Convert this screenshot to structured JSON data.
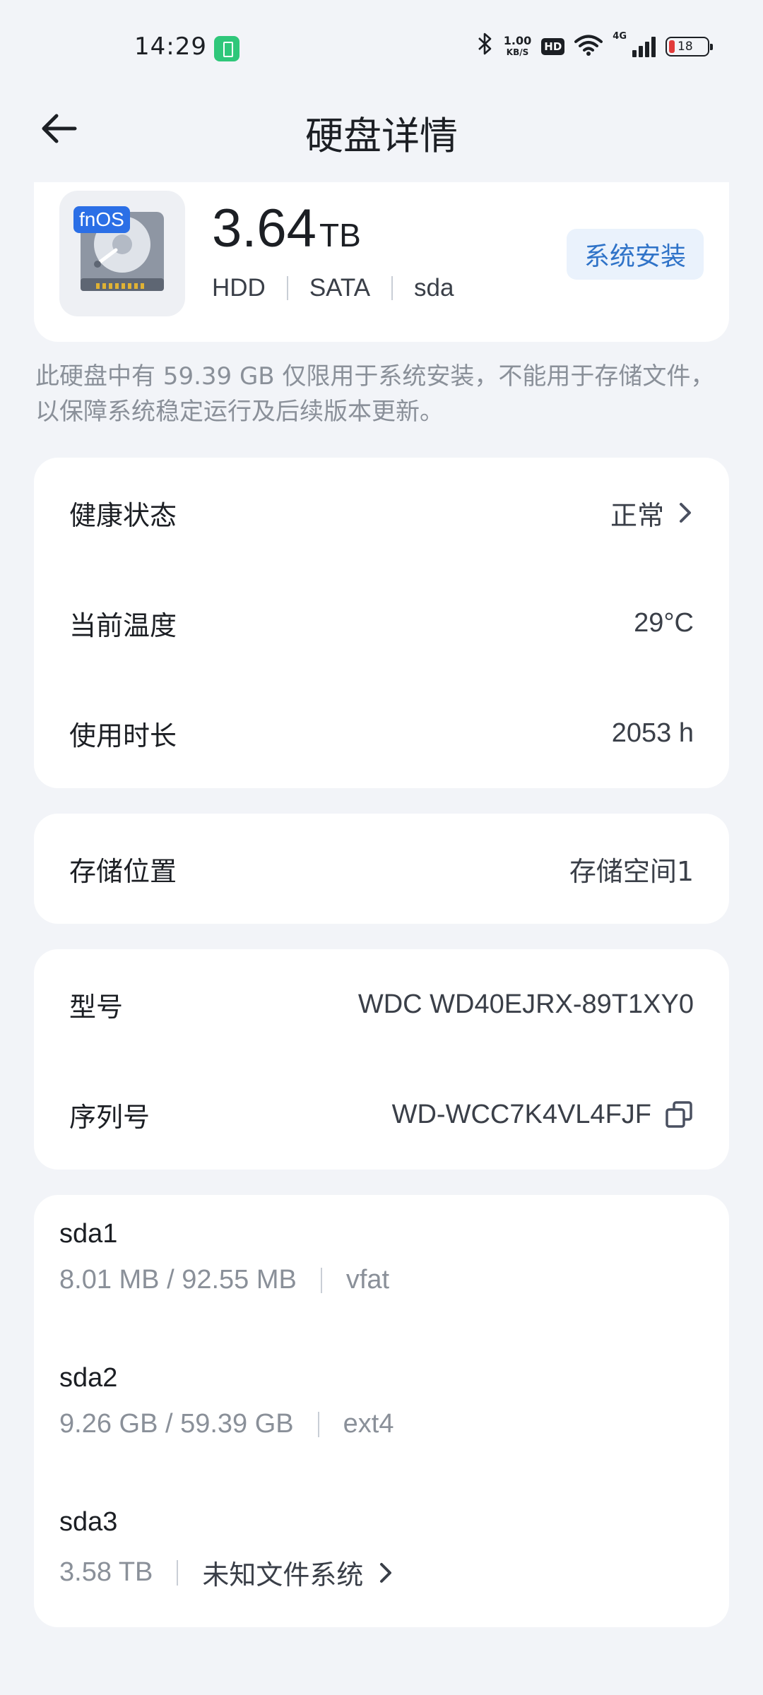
{
  "status_bar": {
    "time": "14:29",
    "net_speed_value": "1.00",
    "net_speed_unit": "KB/S",
    "hd_label": "HD",
    "network_type": "4G",
    "battery_level": "18"
  },
  "header": {
    "title": "硬盘详情"
  },
  "disk": {
    "badge": "fnOS",
    "capacity_value": "3.64",
    "capacity_unit": "TB",
    "type": "HDD",
    "interface": "SATA",
    "device": "sda",
    "tag": "系统安装"
  },
  "notice": "此硬盘中有 59.39 GB 仅限用于系统安装，不能用于存储文件，以保障系统稳定运行及后续版本更新。",
  "health": {
    "status_label": "健康状态",
    "status_value": "正常",
    "temp_label": "当前温度",
    "temp_value": "29°C",
    "usage_label": "使用时长",
    "usage_value": "2053 h"
  },
  "location": {
    "label": "存储位置",
    "value": "存储空间1"
  },
  "device_info": {
    "model_label": "型号",
    "model_value": "WDC WD40EJRX-89T1XY0",
    "serial_label": "序列号",
    "serial_value": "WD-WCC7K4VL4FJF"
  },
  "partitions": [
    {
      "name": "sda1",
      "size": "8.01 MB / 92.55 MB",
      "fs": "vfat"
    },
    {
      "name": "sda2",
      "size": "9.26 GB / 59.39 GB",
      "fs": "ext4"
    },
    {
      "name": "sda3",
      "size": "3.58 TB",
      "fs": "未知文件系统"
    }
  ],
  "colors": {
    "accent": "#2f73c8",
    "background": "#f2f4f8",
    "card": "#ffffff",
    "muted": "#8a9099"
  }
}
